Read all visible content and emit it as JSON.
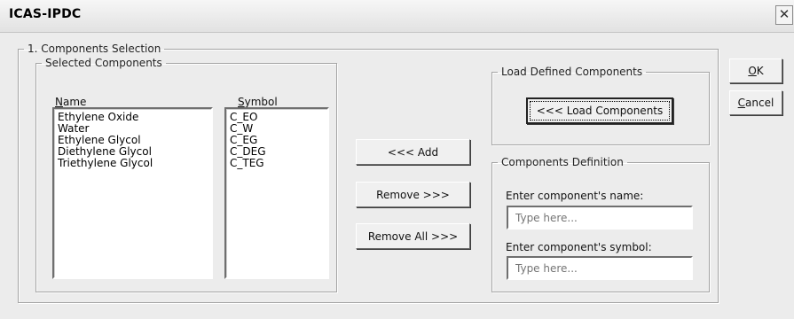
{
  "window": {
    "title": "ICAS-IPDC",
    "close_glyph": "✕"
  },
  "components_selection": {
    "legend": "1. Components Selection",
    "selected_components": {
      "legend": "Selected Components",
      "name_header_accel": "N",
      "name_header_rest": "ame",
      "symbol_header_accel": "S",
      "symbol_header_rest": "ymbol",
      "names": [
        "Ethylene Oxide",
        "Water",
        "Ethylene Glycol",
        "Diethylene Glycol",
        "Triethylene Glycol"
      ],
      "symbols": [
        "C_EO",
        "C_W",
        "C_EG",
        "C_DEG",
        "C_TEG"
      ]
    },
    "buttons": {
      "add": "<<< Add",
      "remove": "Remove >>>",
      "remove_all": "Remove All >>>"
    },
    "load_defined": {
      "legend": "Load Defined Components",
      "button": "<<< Load Components"
    },
    "definition": {
      "legend": "Components Definition",
      "name_label": "Enter component's name:",
      "name_placeholder": "Type here...",
      "symbol_label": "Enter component's symbol:",
      "symbol_placeholder": "Type here..."
    }
  },
  "dialog_buttons": {
    "ok_accel": "O",
    "ok_rest": "K",
    "cancel_accel": "C",
    "cancel_rest": "ancel"
  }
}
